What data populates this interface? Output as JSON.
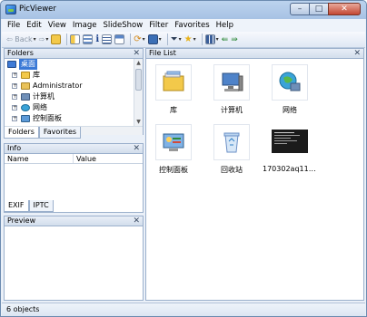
{
  "window": {
    "title": "PicViewer"
  },
  "menu": [
    "File",
    "Edit",
    "View",
    "Image",
    "SlideShow",
    "Filter",
    "Favorites",
    "Help"
  ],
  "toolbar": {
    "back_label": "Back"
  },
  "folders": {
    "title": "Folders",
    "items": [
      {
        "label": "桌面",
        "selected": true
      },
      {
        "label": "库"
      },
      {
        "label": "Administrator"
      },
      {
        "label": "计算机"
      },
      {
        "label": "网络"
      },
      {
        "label": "控制面板"
      }
    ],
    "tabs": [
      "Folders",
      "Favorites"
    ]
  },
  "info": {
    "title": "Info",
    "columns": [
      "Name",
      "Value"
    ],
    "tabs": [
      "EXIF",
      "IPTC"
    ]
  },
  "preview": {
    "title": "Preview"
  },
  "file_list": {
    "title": "File List",
    "items": [
      {
        "label": "库",
        "icon": "library-icon"
      },
      {
        "label": "计算机",
        "icon": "computer-icon"
      },
      {
        "label": "网络",
        "icon": "network-icon"
      },
      {
        "label": "控制面板",
        "icon": "control-panel-icon"
      },
      {
        "label": "回收站",
        "icon": "recycle-bin-icon"
      },
      {
        "label": "170302aq11677...",
        "icon": "image-thumbnail"
      }
    ]
  },
  "status": {
    "text": "6 objects"
  }
}
